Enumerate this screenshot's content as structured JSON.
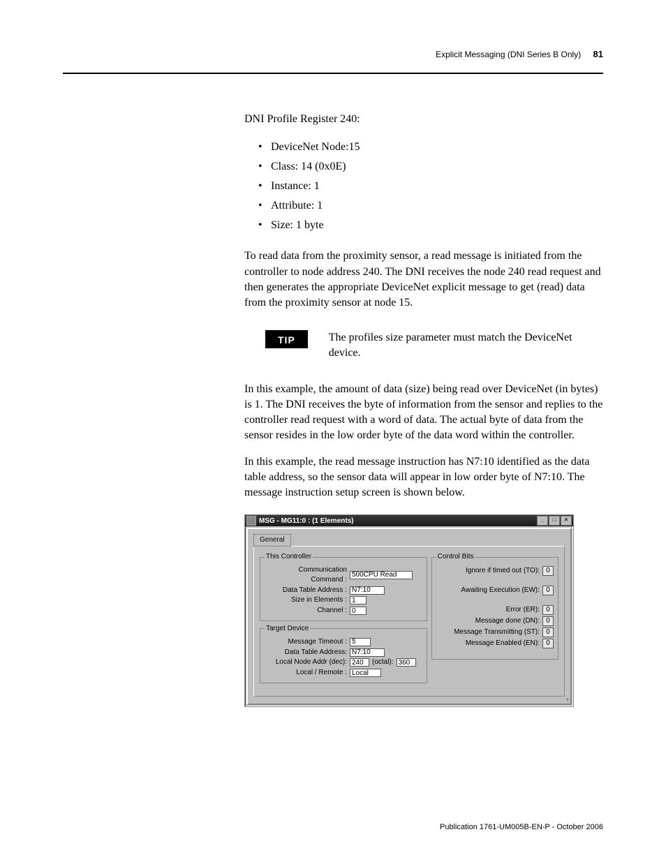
{
  "header": {
    "section": "Explicit Messaging (DNI Series B Only)",
    "page_number": "81"
  },
  "body": {
    "heading1": "DNI Profile Register 240:",
    "bullets": [
      "DeviceNet Node:15",
      "Class: 14 (0x0E)",
      "Instance: 1",
      "Attribute: 1",
      "Size: 1 byte"
    ],
    "para1": "To read data from the proximity sensor, a read message is initiated from the controller to node address 240. The DNI receives the node 240 read request and then generates the appropriate DeviceNet explicit message to get (read) data from the proximity sensor at node 15.",
    "tip_label": "TIP",
    "tip_text": "The profiles size parameter must match the DeviceNet device.",
    "para2": "In this example, the amount of data (size) being read over DeviceNet (in bytes) is 1. The DNI receives the byte of information from the sensor and replies to the controller read request with a word of data. The actual byte of data from the sensor resides in the low order byte of the data word within the controller.",
    "para3": "In this example, the read message instruction has N7:10 identified as the data table address, so the sensor data will appear in low order byte of N7:10. The message instruction setup screen is shown below."
  },
  "dialog": {
    "title": "MSG - MG11:0 : (1 Elements)",
    "tab": "General",
    "group_controller": {
      "legend": "This Controller",
      "comm_cmd_label": "Communication Command :",
      "comm_cmd_value": "500CPU Read",
      "dta_label": "Data Table Address :",
      "dta_value": "N7:10",
      "size_label": "Size in Elements :",
      "size_value": "1",
      "channel_label": "Channel :",
      "channel_value": "0"
    },
    "group_target": {
      "legend": "Target Device",
      "timeout_label": "Message Timeout :",
      "timeout_value": "5",
      "dta_label": "Data Table Address:",
      "dta_value": "N7:10",
      "node_label": "Local Node Addr (dec):",
      "node_dec": "240",
      "node_octal_label": "(octal):",
      "node_octal": "360",
      "lr_label": "Local / Remote :",
      "lr_value": "Local"
    },
    "group_bits": {
      "legend": "Control Bits",
      "to_label": "Ignore if timed out (TO):",
      "to_value": "0",
      "ew_label": "Awaiting Execution (EW):",
      "ew_value": "0",
      "er_label": "Error (ER):",
      "er_value": "0",
      "dn_label": "Message done (DN):",
      "dn_value": "0",
      "st_label": "Message Transmitting (ST):",
      "st_value": "0",
      "en_label": "Message Enabled (EN):",
      "en_value": "0"
    }
  },
  "footer": {
    "publication": "Publication 1761-UM005B-EN-P - October 2006"
  }
}
